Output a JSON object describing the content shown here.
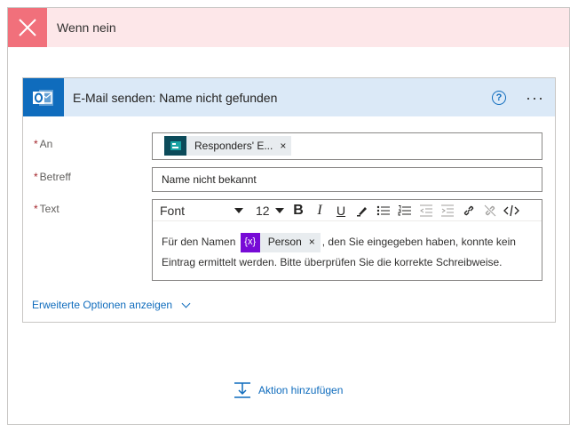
{
  "condition": {
    "title": "Wenn nein",
    "accent": "#f1707b",
    "background": "#fde7e9"
  },
  "action": {
    "title": "E-Mail senden: Name nicht gefunden",
    "help": "?",
    "more": "···",
    "fields": {
      "an": {
        "label": "An",
        "required_mark": "*",
        "token": "Responders' E...",
        "token_close": "×"
      },
      "betreff": {
        "label": "Betreff",
        "required_mark": "*",
        "value": "Name nicht bekannt"
      },
      "text": {
        "label": "Text",
        "required_mark": "*",
        "toolbar": {
          "font": "Font",
          "size": "12",
          "bold": "B",
          "italic": "I",
          "underline": "U"
        },
        "before_token": "Für den Namen",
        "token_icon": "{x}",
        "token": "Person",
        "token_close": "×",
        "after_token": ", den Sie eingegeben haben, konnte kein Eintrag ermittelt werden. Bitte überprüfen Sie die korrekte Schreibweise."
      }
    },
    "advanced_options": "Erweiterte Optionen anzeigen"
  },
  "add_action": "Aktion hinzufügen",
  "colors": {
    "link": "#0f6cbd",
    "header_blue": "#dbe9f7",
    "outlook_blue": "#0f6cbd",
    "variable_purple": "#770bd6"
  }
}
